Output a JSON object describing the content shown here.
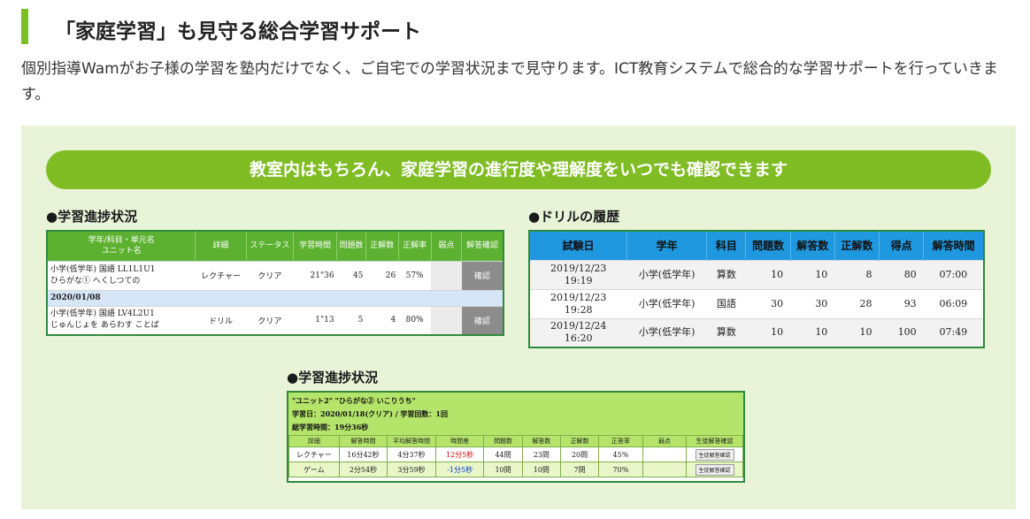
{
  "heading": "「家庭学習」も見守る総合学習サポート",
  "intro": "個別指導Wamがお子様の学習を塾内だけでなく、ご自宅での学習状況まで見守ります。ICT教育システムで総合的な学習サポートを行っていきます。",
  "banner": "教室内はもちろん、家庭学習の進行度や理解度をいつでも確認できます",
  "progress1": {
    "title": "●学習進捗状況",
    "headers": [
      "学年/科目・単元名\nユニット名",
      "詳細",
      "ステータス",
      "学習時間",
      "問題数",
      "正解数",
      "正解率",
      "弱点",
      "解答確認"
    ],
    "rows": [
      {
        "unit": "小学(低学年) 国語 LL1L1U1\nひらがな① へくしつての",
        "detail": "レクチャー",
        "status": "クリア",
        "time": "21\"36",
        "questions": "45",
        "correct": "26",
        "rate": "57%",
        "weak": "",
        "confirm": "確認"
      },
      {
        "date": "2020/01/08"
      },
      {
        "unit": "小学(低学年) 国語 LV4L2U1\nじゅんじょを あらわす ことば",
        "detail": "ドリル",
        "status": "クリア",
        "time": "1\"13",
        "questions": "5",
        "correct": "4",
        "rate": "80%",
        "weak": "",
        "confirm": "確認"
      }
    ]
  },
  "drill": {
    "title": "●ドリルの履歴",
    "headers": [
      "試験日",
      "学年",
      "科目",
      "問題数",
      "解答数",
      "正解数",
      "得点",
      "解答時間"
    ],
    "rows": [
      [
        "2019/12/23\n19:19",
        "小学(低学年)",
        "算数",
        "10",
        "10",
        "8",
        "80",
        "07:00"
      ],
      [
        "2019/12/23\n19:28",
        "小学(低学年)",
        "国語",
        "30",
        "30",
        "28",
        "93",
        "06:09"
      ],
      [
        "2019/12/24\n16:20",
        "小学(低学年)",
        "算数",
        "10",
        "10",
        "10",
        "100",
        "07:49"
      ]
    ]
  },
  "progress2": {
    "title": "●学習進捗状況",
    "line1": "\"ユニット2\" \"ひらがな② いこりうち\"",
    "line2": "学習日：2020/01/18(クリア) / 学習回数：1回",
    "line3": "総学習時間：19分36秒",
    "headers": [
      "詳細",
      "解答時間",
      "平均解答時間",
      "時間差",
      "問題数",
      "解答数",
      "正解数",
      "正答率",
      "弱点",
      "生徒解答確認"
    ],
    "rows": [
      [
        "レクチャー",
        "16分42秒",
        "4分37秒",
        "12分5秒",
        "44問",
        "23問",
        "20問",
        "45%",
        "",
        "生徒解答確認"
      ],
      [
        "ゲーム",
        "2分54秒",
        "3分59秒",
        "-1分5秒",
        "10問",
        "10問",
        "7問",
        "70%",
        "",
        "生徒解答確認"
      ]
    ]
  },
  "colors": {
    "accent": "#7cbd2a",
    "panel_bg": "#e8f3d8",
    "table_header_blue": "#1f98df",
    "diff_positive": "#e00000",
    "diff_negative": "#0033cc"
  }
}
